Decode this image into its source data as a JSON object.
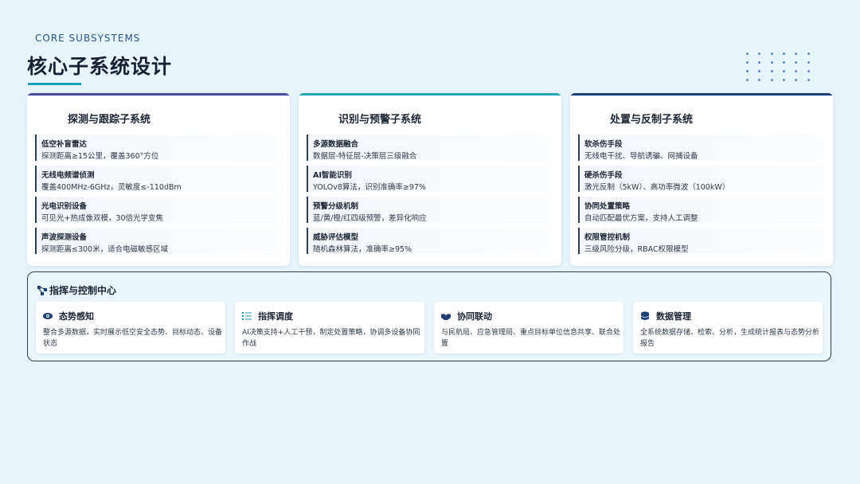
{
  "header": {
    "eyebrow": "CORE SUBSYSTEMS",
    "title": "核心子系统设计"
  },
  "subsystems": [
    {
      "title": "探测与跟踪子系统",
      "accent": "#4a4aa0",
      "items": [
        {
          "heading": "低空补盲雷达",
          "desc": "探测距离≥15公里，覆盖360°方位"
        },
        {
          "heading": "无线电频谱侦测",
          "desc": "覆盖400MHz-6GHz，灵敏度≤-110dBm"
        },
        {
          "heading": "光电识别设备",
          "desc": "可见光+热成像双模，30倍光学变焦"
        },
        {
          "heading": "声波探测设备",
          "desc": "探测距离≤300米，适合电磁敏感区域"
        }
      ]
    },
    {
      "title": "识别与预警子系统",
      "accent": "#22a8b4",
      "items": [
        {
          "heading": "多源数据融合",
          "desc": "数据层-特征层-决策层三级融合"
        },
        {
          "heading": "AI智能识别",
          "desc": "YOLOv8算法，识别准确率≥97%"
        },
        {
          "heading": "预警分级机制",
          "desc": "蓝/黄/橙/红四级预警，差异化响应"
        },
        {
          "heading": "威胁评估模型",
          "desc": "随机森林算法，准确率≥95%"
        }
      ]
    },
    {
      "title": "处置与反制子系统",
      "accent": "#1f3f78",
      "items": [
        {
          "heading": "软杀伤手段",
          "desc": "无线电干扰、导航诱骗、网捕设备"
        },
        {
          "heading": "硬杀伤手段",
          "desc": "激光反制（5kW）、高功率微波（100kW）"
        },
        {
          "heading": "协同处置策略",
          "desc": "自动匹配最优方案，支持人工调整"
        },
        {
          "heading": "权限管控机制",
          "desc": "三级风险分级，RBAC权限模型"
        }
      ]
    }
  ],
  "command_center": {
    "title": "指挥与控制中心",
    "icon": "network-icon",
    "modules": [
      {
        "title": "态势感知",
        "icon": "eye-icon",
        "desc": "整合多源数据，实时展示低空安全态势、目标动态、设备状态"
      },
      {
        "title": "指挥调度",
        "icon": "list-icon",
        "desc": "AI决策支持+人工干预，制定处置策略，协调多设备协同作战"
      },
      {
        "title": "协同联动",
        "icon": "handshake-icon",
        "desc": "与民航局、应急管理局、重点目标单位信息共享、联合处置"
      },
      {
        "title": "数据管理",
        "icon": "database-icon",
        "desc": "全系统数据存储、检索、分析，生成统计报表与态势分析报告"
      }
    ]
  }
}
